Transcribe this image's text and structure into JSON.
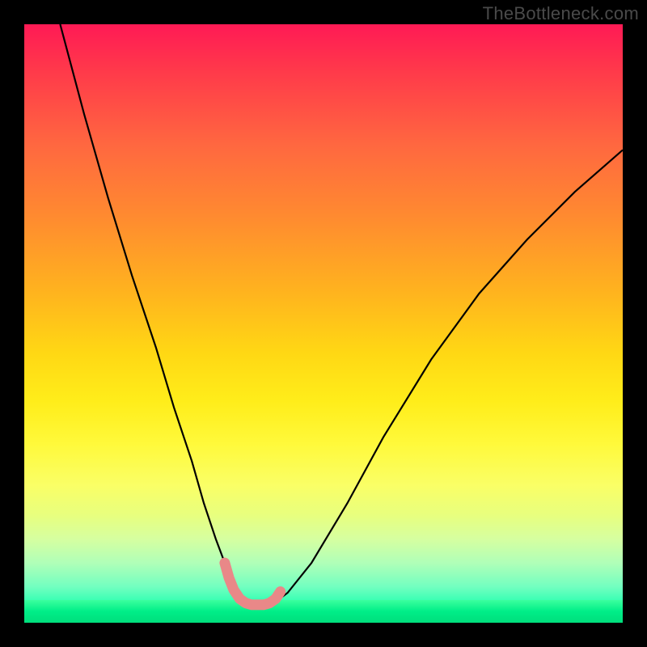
{
  "watermark_text": "TheBottleneck.com",
  "chart_data": {
    "type": "line",
    "title": "",
    "xlabel": "",
    "ylabel": "",
    "xlim": [
      0,
      100
    ],
    "ylim": [
      0,
      100
    ],
    "grid": false,
    "legend": false,
    "series": [
      {
        "name": "bottleneck-curve",
        "color": "#000000",
        "x": [
          6,
          10,
          14,
          18,
          22,
          25,
          28,
          30,
          32,
          33.5,
          35,
          36,
          37,
          38,
          40,
          42,
          44,
          48,
          54,
          60,
          68,
          76,
          84,
          92,
          100
        ],
        "y": [
          100,
          85,
          71,
          58,
          46,
          36,
          27,
          20,
          14,
          10,
          6,
          4,
          3.2,
          3,
          3,
          3.5,
          5,
          10,
          20,
          31,
          44,
          55,
          64,
          72,
          79
        ]
      },
      {
        "name": "highlight-range",
        "color": "#e98888",
        "x": [
          33.5,
          34.2,
          35,
          36,
          37,
          38,
          39,
          40,
          41,
          42,
          42.8
        ],
        "y": [
          10,
          7.5,
          5.5,
          4,
          3.3,
          3,
          3,
          3,
          3.3,
          4,
          5.2
        ]
      }
    ],
    "annotations": []
  },
  "colors": {
    "background": "#000000",
    "gradient_top": "#ff1a55",
    "gradient_bottom": "#00ee90",
    "curve": "#000000",
    "highlight": "#e98888",
    "watermark": "#4a4a4a"
  }
}
